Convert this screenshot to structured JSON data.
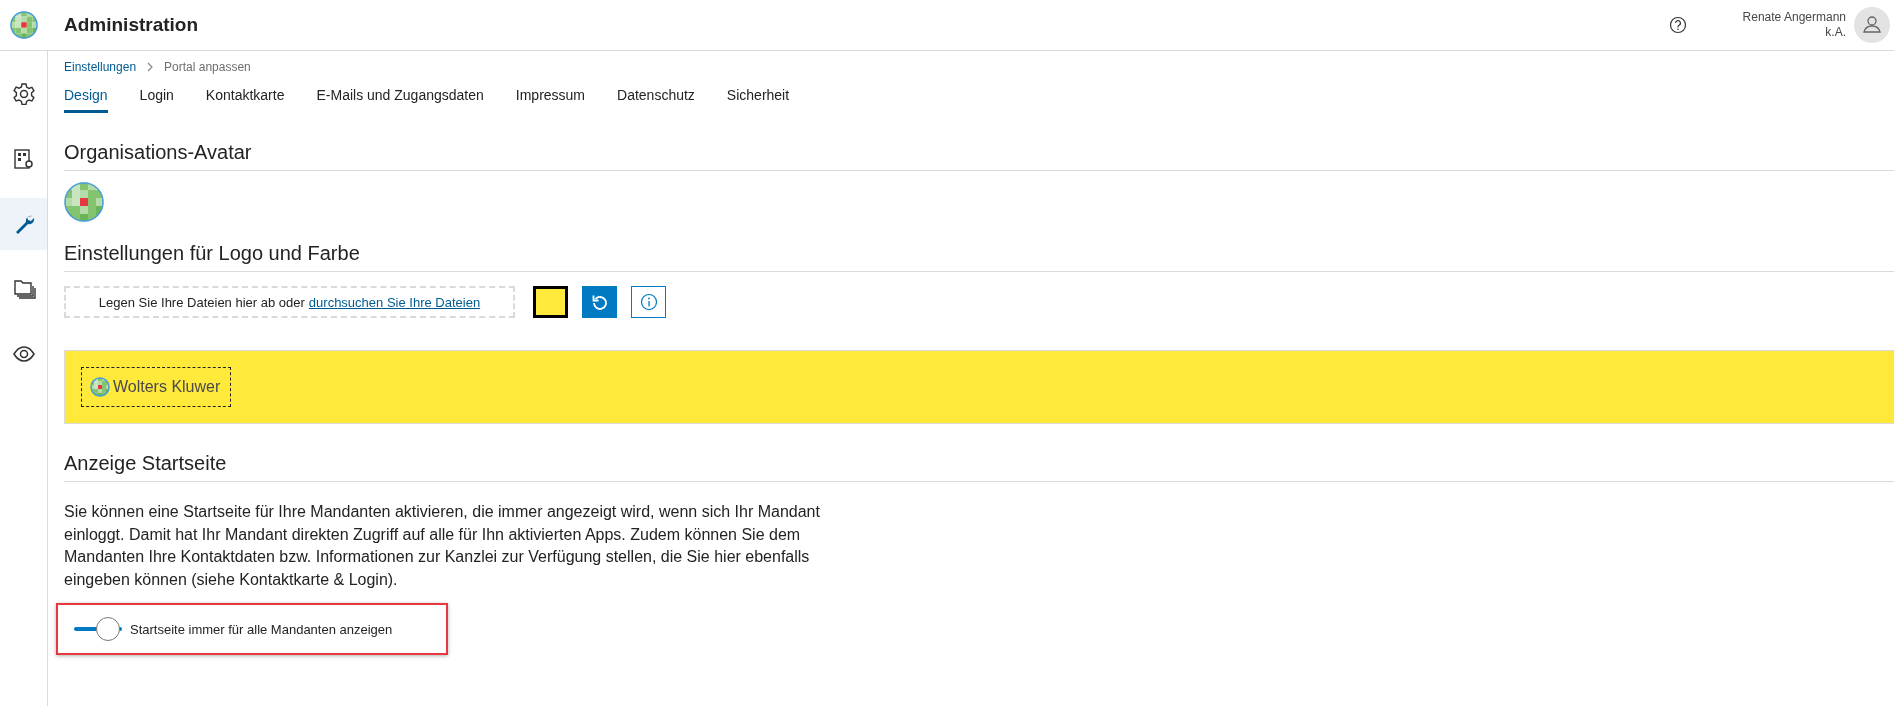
{
  "header": {
    "title": "Administration",
    "user_name": "Renate Angermann",
    "user_role": "k.A."
  },
  "sidebar": {
    "items": [
      {
        "selected": false
      },
      {
        "selected": false
      },
      {
        "selected": true
      },
      {
        "selected": false
      },
      {
        "selected": false
      }
    ]
  },
  "breadcrumb": [
    {
      "label": "Einstellungen",
      "link": true
    },
    {
      "label": "Portal anpassen",
      "link": false
    }
  ],
  "tabs": [
    {
      "label": "Design",
      "selected": true
    },
    {
      "label": "Login",
      "selected": false
    },
    {
      "label": "Kontaktkarte",
      "selected": false
    },
    {
      "label": "E-Mails und Zugangsdaten",
      "selected": false
    },
    {
      "label": "Impressum",
      "selected": false
    },
    {
      "label": "Datenschutz",
      "selected": false
    },
    {
      "label": "Sicherheit",
      "selected": false
    }
  ],
  "avatar_section": {
    "heading": "Organisations-Avatar"
  },
  "logo_section": {
    "heading": "Einstellungen für Logo und Farbe",
    "dropzone_text": "Legen Sie Ihre Dateien hier ab oder",
    "dropzone_link": "durchsuchen Sie Ihre Dateien",
    "color": "#ffe93b",
    "logo_text": "Wolters Kluwer"
  },
  "start_section": {
    "heading": "Anzeige Startseite",
    "description": "Sie können eine Startseite für Ihre Mandanten aktivieren, die immer angezeigt wird, wenn sich Ihr Mandant einloggt. Damit hat Ihr Mandant direkten Zugriff auf alle für Ihn aktivierten Apps. Zudem können Sie dem Mandanten Ihre Kontaktdaten bzw. Informationen zur Kanzlei zur Verfügung stellen, die Sie hier ebenfalls eingeben können (siehe Kontaktkarte & Login).",
    "toggle": {
      "label": "Startseite immer für alle Mandanten anzeigen",
      "on": true,
      "highlighted": true
    }
  }
}
